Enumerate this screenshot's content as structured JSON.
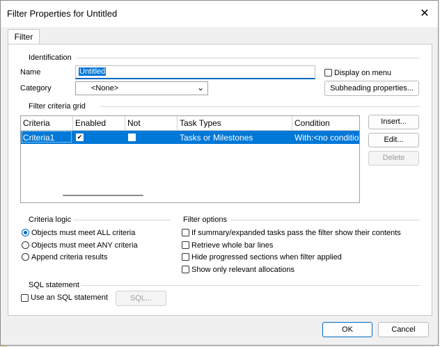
{
  "window": {
    "title": "Filter Properties for Untitled"
  },
  "tabs": [
    {
      "label": "Filter"
    }
  ],
  "identification": {
    "group_label": "Identification",
    "name_label": "Name",
    "name_value": "Untitled",
    "category_label": "Category",
    "category_value": "<None>",
    "display_on_menu_label": "Display on menu",
    "display_on_menu_checked": false,
    "subheading_button": "Subheading properties..."
  },
  "criteria_grid": {
    "group_label": "Filter criteria grid",
    "columns": [
      "Criteria",
      "Enabled",
      "Not",
      "Task Types",
      "Condition"
    ],
    "rows": [
      {
        "criteria": "Criteria1",
        "enabled": true,
        "not": false,
        "task_types": "Tasks or Milestones",
        "condition": "With:<no conditio"
      }
    ],
    "buttons": {
      "insert": "Insert...",
      "edit": "Edit...",
      "delete": "Delete"
    }
  },
  "criteria_logic": {
    "group_label": "Criteria logic",
    "options": [
      "Objects must meet ALL criteria",
      "Objects must meet ANY criteria",
      "Append criteria results"
    ],
    "selected_index": 0
  },
  "filter_options": {
    "group_label": "Filter options",
    "options": [
      {
        "label": "If summary/expanded tasks pass the filter show their contents",
        "checked": false
      },
      {
        "label": "Retrieve whole bar lines",
        "checked": false
      },
      {
        "label": "Hide progressed sections when filter applied",
        "checked": false
      },
      {
        "label": "Show only relevant allocations",
        "checked": false
      }
    ]
  },
  "sql": {
    "group_label": "SQL statement",
    "use_sql_label": "Use an SQL statement",
    "use_sql_checked": false,
    "sql_button": "SQL..."
  },
  "footer": {
    "ok": "OK",
    "cancel": "Cancel"
  },
  "icons": {
    "close": "close-icon",
    "dropdown": "chevron-down-icon",
    "checkmark": "check-icon"
  },
  "colors": {
    "selection": "#0078d7",
    "accent": "#0067c0"
  }
}
